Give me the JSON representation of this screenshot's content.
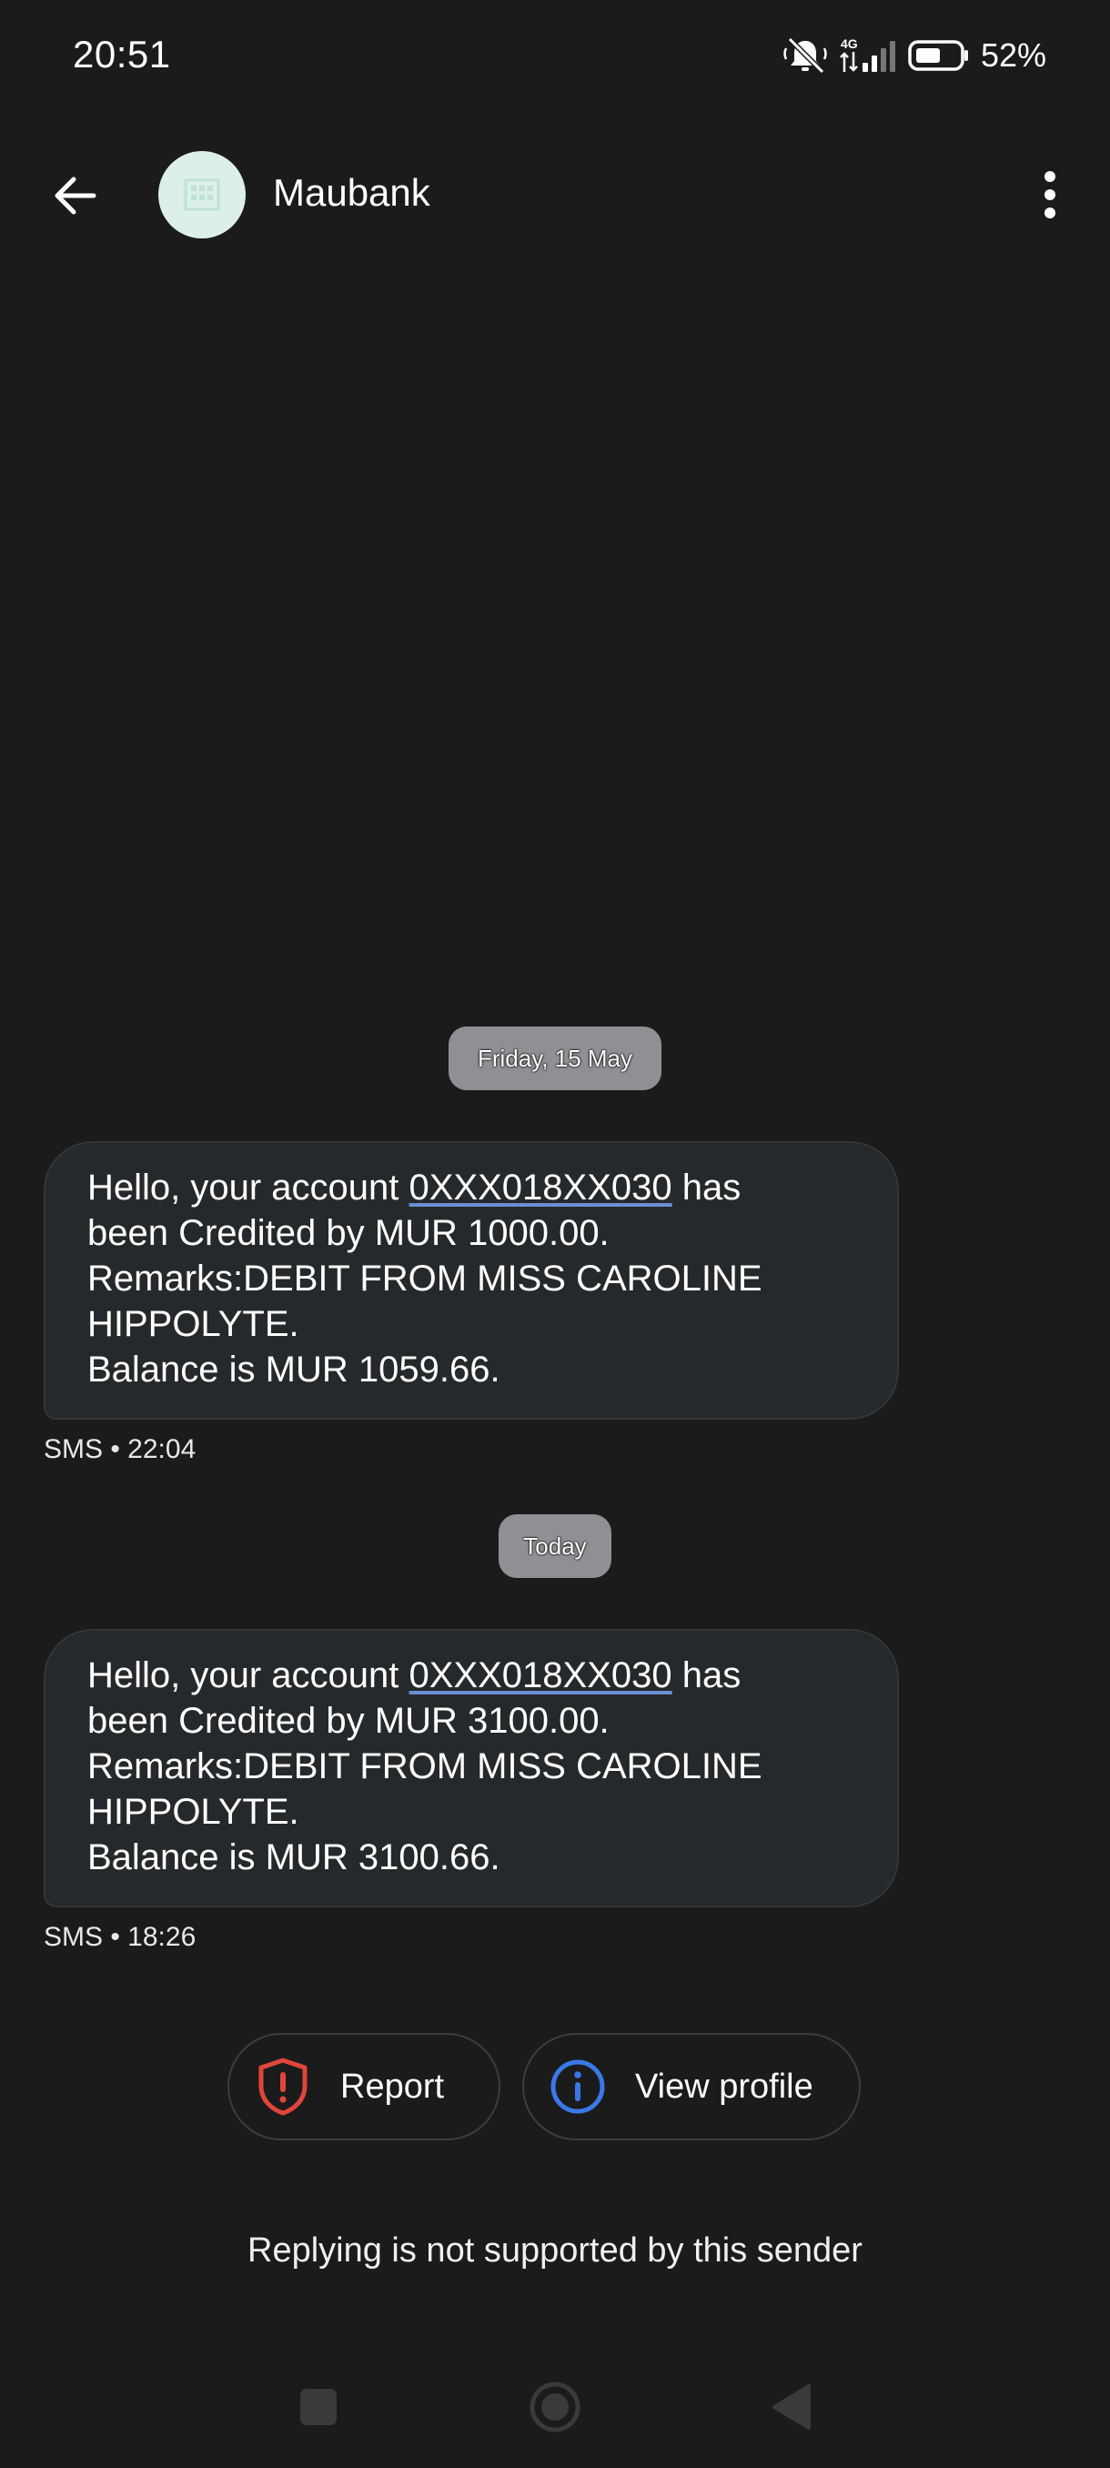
{
  "status_bar": {
    "time": "20:51",
    "network": "4G",
    "battery": "52%",
    "icons": [
      "mute-icon",
      "signal-icon",
      "battery-icon"
    ]
  },
  "app_bar": {
    "sender": "Maubank",
    "icons": [
      "back-arrow-icon",
      "building-icon",
      "more-vert-icon"
    ]
  },
  "conversation": {
    "groups": [
      {
        "date": "Friday, 15 May",
        "message": {
          "prefix": "Hello, your account ",
          "account": "0XXX018XX030",
          "line1_suffix": " has",
          "line2": "been Credited by MUR 1000.00.",
          "line3": "Remarks:DEBIT FROM MISS CAROLINE",
          "line4": "HIPPOLYTE.",
          "line5": "Balance is MUR 1059.66."
        },
        "meta": "SMS • 22:04"
      },
      {
        "date": "Today",
        "message": {
          "prefix": "Hello, your account ",
          "account": "0XXX018XX030",
          "line1_suffix": " has",
          "line2": "been Credited by MUR 3100.00.",
          "line3": "Remarks:DEBIT FROM MISS CAROLINE",
          "line4": "HIPPOLYTE.",
          "line5": "Balance is MUR 3100.66."
        },
        "meta": "SMS • 18:26"
      }
    ]
  },
  "actions": {
    "report_label": "Report",
    "view_profile_label": "View profile"
  },
  "reply_note": "Replying is not supported by this sender",
  "colors": {
    "background": "#1b1b1b",
    "bubble": "#26292b",
    "avatar": "#dcefe9",
    "report_icon": "#e0463a",
    "info_icon": "#3a78e8",
    "date_chip": "#8e9094"
  }
}
